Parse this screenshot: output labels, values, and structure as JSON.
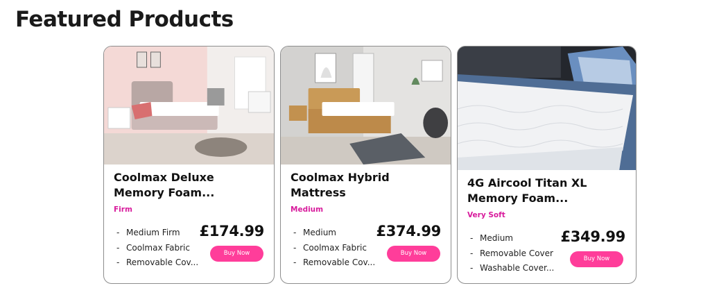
{
  "section": {
    "title": "Featured Products"
  },
  "products": [
    {
      "name": "Coolmax Deluxe Memory Foam...",
      "firmness": "Firm",
      "features": [
        "Medium Firm",
        "Coolmax Fabric",
        "Removable Cov..."
      ],
      "price": "£174.99",
      "button": "Buy Now"
    },
    {
      "name": "Coolmax Hybrid Mattress",
      "firmness": "Medium",
      "features": [
        "Medium",
        "Coolmax Fabric",
        "Removable Cov..."
      ],
      "price": "£374.99",
      "button": "Buy Now"
    },
    {
      "name": "4G Aircool Titan XL Memory Foam...",
      "firmness": "Very Soft",
      "features": [
        "Medium",
        "Removable Cover",
        "Washable Cover..."
      ],
      "price": "£349.99",
      "button": "Buy Now"
    }
  ],
  "colors": {
    "accent": "#d81b9c",
    "button": "#ff3d9a"
  }
}
